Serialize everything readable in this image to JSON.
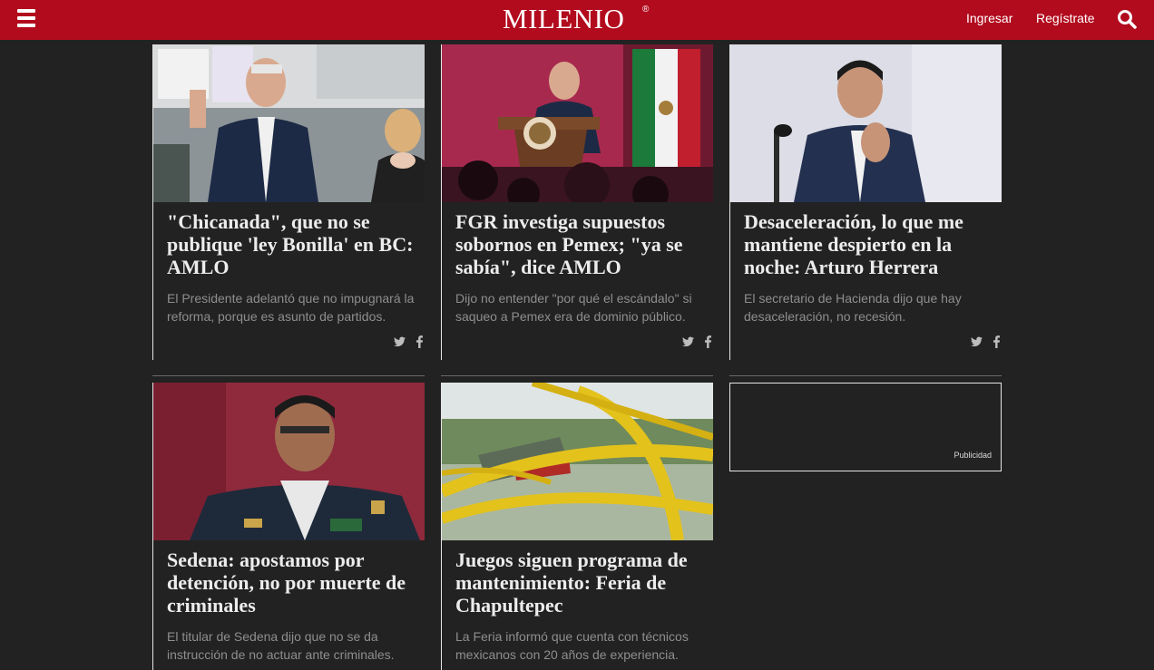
{
  "header": {
    "logo": "MILENIO",
    "logo_mark": "®",
    "login": "Ingresar",
    "register": "Regístrate",
    "brand_color": "#b20b1e"
  },
  "articles": [
    {
      "title": "\"Chicanada\", que no se publique 'ley Bonilla' en BC: AMLO",
      "summary": "El Presidente adelantó que no impugnará la reforma, porque es asunto de partidos.",
      "image": "politician-thumbs-up-photo"
    },
    {
      "title": "FGR investiga supuestos sobornos en Pemex; \"ya se sabía\", dice AMLO",
      "summary": "Dijo no entender \"por qué el escándalo\" si saqueo a Pemex era de dominio público.",
      "image": "podium-speech-photo"
    },
    {
      "title": "Desaceleración, lo que me mantiene despierto en la noche: Arturo Herrera",
      "summary": "El secretario de Hacienda dijo que hay desaceleración, no recesión.",
      "image": "secretary-microphone-photo"
    },
    {
      "title": "Sedena: apostamos por detención, no por muerte de criminales",
      "summary": "El titular de Sedena dijo que no se da instrucción de no actuar ante criminales.",
      "image": "general-uniform-photo"
    },
    {
      "title": "Juegos siguen programa de mantenimiento: Feria de Chapultepec",
      "summary": "La Feria informó que cuenta con técnicos mexicanos con 20 años de experiencia.",
      "image": "roller-coaster-photo"
    }
  ],
  "ad": {
    "label": "Publicidad"
  },
  "icons": {
    "menu": "hamburger-icon",
    "search": "search-icon",
    "twitter": "twitter-icon",
    "facebook": "facebook-icon"
  }
}
